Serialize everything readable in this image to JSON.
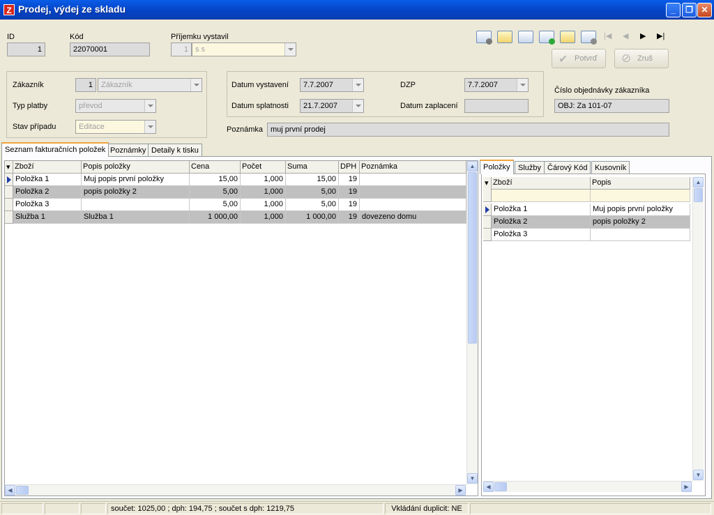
{
  "window": {
    "title": "Prodej, výdej ze skladu",
    "app_icon": "Z"
  },
  "header": {
    "id_label": "ID",
    "id_value": "1",
    "kod_label": "Kód",
    "kod_value": "22070001",
    "vystavil_label": "Příjemku vystavil",
    "vystavil_id": "1",
    "vystavil_name": "s s"
  },
  "toolbar": {
    "confirm_label": "Potvrď",
    "cancel_label": "Zruš"
  },
  "customer": {
    "zakaznik_label": "Zákazník",
    "zakaznik_id": "1",
    "zakaznik_name": "Zákazník",
    "typ_platby_label": "Typ platby",
    "typ_platby_value": "převod",
    "stav_label": "Stav případu",
    "stav_value": "Editace"
  },
  "dates": {
    "vystaveni_label": "Datum vystavení",
    "vystaveni_value": "7.7.2007",
    "splatnosti_label": "Datum splatnosti",
    "splatnosti_value": "21.7.2007",
    "dzp_label": "DZP",
    "dzp_value": "7.7.2007",
    "zaplaceni_label": "Datum zaplacení",
    "zaplaceni_value": ""
  },
  "order": {
    "label": "Číslo objednávky zákazníka",
    "value": "OBJ: Za 101-07"
  },
  "note": {
    "label": "Poznámka",
    "value": "muj první prodej"
  },
  "tabs": [
    {
      "label": "Seznam fakturačních položek"
    },
    {
      "label": "Poznámky"
    },
    {
      "label": "Detaily k tisku"
    }
  ],
  "items_grid": {
    "columns": [
      "Zboží",
      "Popis položky",
      "Cena",
      "Počet",
      "Suma",
      "DPH",
      "Poznámka"
    ],
    "rows": [
      [
        "Položka 1",
        "Muj popis první položky",
        "15,00",
        "1,000",
        "15,00",
        "19",
        ""
      ],
      [
        "Položka 2",
        "popis položky 2",
        "5,00",
        "1,000",
        "5,00",
        "19",
        ""
      ],
      [
        "Položka 3",
        "",
        "5,00",
        "1,000",
        "5,00",
        "19",
        ""
      ],
      [
        "Služba 1",
        "Služba 1",
        "1 000,00",
        "1,000",
        "1 000,00",
        "19",
        "dovezeno domu"
      ]
    ]
  },
  "side_tabs": [
    {
      "label": "Položky"
    },
    {
      "label": "Služby"
    },
    {
      "label": "Čárový Kód"
    },
    {
      "label": "Kusovník"
    }
  ],
  "side_grid": {
    "columns": [
      "Zboží",
      "Popis"
    ],
    "rows": [
      [
        "Položka 1",
        "Muj popis první položky"
      ],
      [
        "Položka 2",
        "popis položky 2"
      ],
      [
        "Položka 3",
        ""
      ]
    ]
  },
  "status": {
    "sum_text": "součet: 1025,00 ;  dph:  194,75 ;  součet s dph:  1219,75",
    "dup_text": "Vkládání duplicit:  NE"
  },
  "colors": {
    "titlebar": "#0442c4",
    "selected_row": "#c0c0c0",
    "tab_accent": "#f1a33b"
  }
}
